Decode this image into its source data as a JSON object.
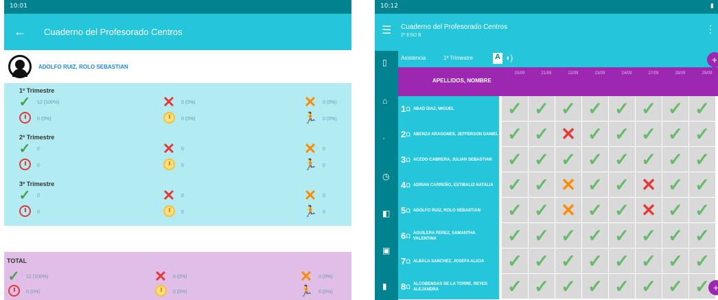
{
  "left": {
    "status_time": "10:01",
    "title": "Cuaderno del Profesorado Centros",
    "student_name": "ADOLFO RUIZ, ROLO SEBASTIAN",
    "trimesters": [
      {
        "name": "1º Trimestre",
        "check": "12 (100%)",
        "cross": "0 (0%)",
        "cross_orange": "0 (0%)",
        "clock": "0 (0%)",
        "clock_orange": "0 (0%)",
        "run": "0 (0%)"
      },
      {
        "name": "2º Trimestre",
        "check": "0",
        "cross": "0",
        "cross_orange": "0",
        "clock": "0",
        "clock_orange": "0",
        "run": "0"
      },
      {
        "name": "3º Trimestre",
        "check": "0",
        "cross": "0",
        "cross_orange": "0",
        "clock": "0",
        "clock_orange": "0",
        "run": "0"
      }
    ],
    "total": {
      "name": "TOTAL",
      "check": "12 (100%)",
      "cross": "0 (0%)",
      "cross_orange": "0 (0%)",
      "clock": "0 (0%)",
      "clock_orange": "0 (0%)",
      "run": "0 (0%)"
    }
  },
  "right": {
    "status_time": "10:12",
    "title": "Cuaderno del Profesorado Centros",
    "subtitle": "2º ESO B",
    "filter_1": "Asistencia",
    "filter_2": "1º Trimestre",
    "header_student": "APELLIDOS, NOMBRE",
    "dates": [
      "20/09",
      "21/09",
      "22/09",
      "23/09",
      "24/09",
      "27/09",
      "28/09",
      "29/09"
    ],
    "rows": [
      {
        "num": "1",
        "name": "ABAD DIAZ, MIGUEL",
        "marks": [
          "check",
          "check",
          "check",
          "check",
          "check",
          "check",
          "check",
          "check"
        ]
      },
      {
        "num": "2",
        "name": "ABENZA ARAGONES, JEFFERSON DANIEL",
        "marks": [
          "check",
          "check",
          "cross",
          "check",
          "check",
          "check",
          "check",
          "check"
        ]
      },
      {
        "num": "3",
        "name": "ACEDO CABRERA, JULIAN SEBASTIAN",
        "marks": [
          "check",
          "check",
          "check",
          "check",
          "check",
          "check",
          "check",
          "check"
        ]
      },
      {
        "num": "4",
        "name": "ADRIAN CARREÑO, ESTIBALIZ NATALIA",
        "marks": [
          "check",
          "check",
          "cross-orange",
          "check",
          "check",
          "cross",
          "check",
          "check"
        ]
      },
      {
        "num": "5",
        "name": "ADOLFO RUIZ, ROLO SEBASTIAN",
        "marks": [
          "check",
          "check",
          "cross-orange",
          "check",
          "check",
          "cross",
          "check",
          "check"
        ]
      },
      {
        "num": "6",
        "name": "AGUILERA PEREZ, SAMANTHA VALENTINA",
        "marks": [
          "check",
          "check",
          "check",
          "check",
          "check",
          "check",
          "check",
          "check"
        ]
      },
      {
        "num": "7",
        "name": "ALBALA SANCHEZ, JOSEFA ALICIA",
        "marks": [
          "check",
          "check",
          "check",
          "check",
          "check",
          "check",
          "check",
          "check"
        ]
      },
      {
        "num": "8",
        "name": "ALCOBENDAS DE LA TORRE, REYES ALEJANDRA",
        "marks": [
          "check",
          "check",
          "check",
          "check",
          "check",
          "check",
          "check",
          "check"
        ]
      }
    ]
  }
}
